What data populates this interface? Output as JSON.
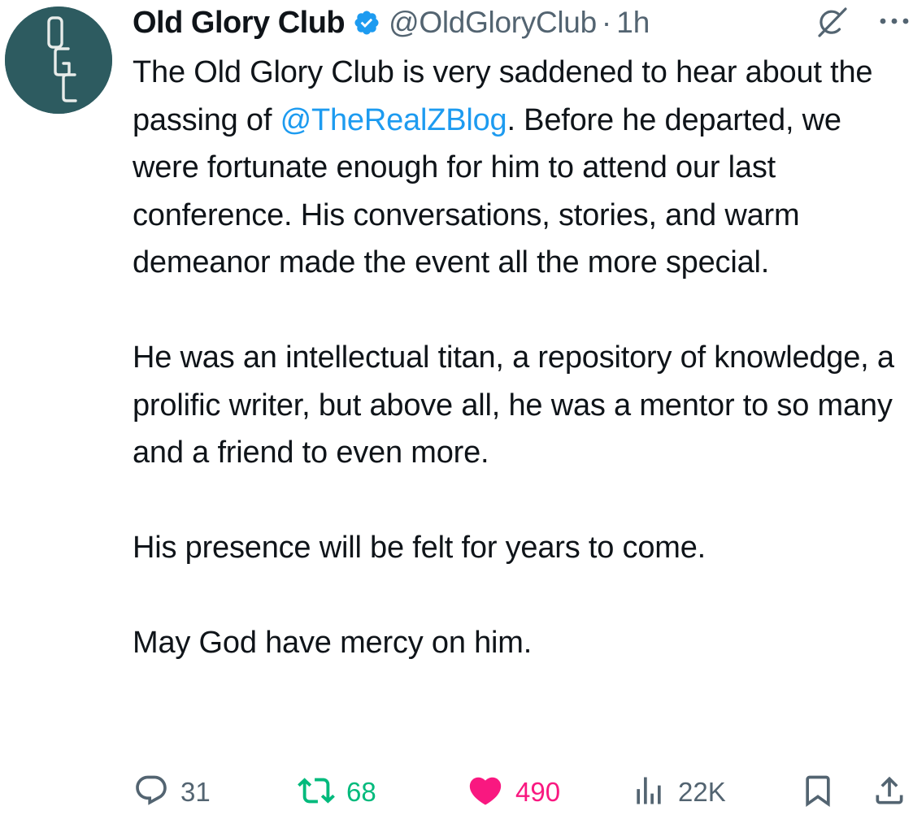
{
  "colors": {
    "avatar_bg": "#2d5b60",
    "verified": "#1d9bf0",
    "mention": "#1d9bf0",
    "retweet_active": "#00ba7c",
    "like_active": "#f91880",
    "muted": "#536471",
    "text": "#0f1419"
  },
  "author": {
    "display_name": "Old Glory Club",
    "handle": "@OldGloryClub",
    "separator": "·",
    "time": "1h",
    "verified": true,
    "avatar_monogram": "OGC"
  },
  "icons": {
    "avatar": "avatar-monogram",
    "verified": "verified-badge-icon",
    "grok": "grok-icon",
    "more": "more-options-icon",
    "reply": "reply-icon",
    "retweet": "retweet-icon",
    "like": "heart-icon",
    "views": "views-icon",
    "bookmark": "bookmark-icon",
    "share": "share-icon"
  },
  "tweet": {
    "p1_before": "The Old Glory Club is very saddened to hear about the passing of ",
    "p1_mention": "@TheRealZBlog",
    "p1_after": ". Before he departed, we were fortunate enough for him to attend our last conference. His conversations, stories, and warm demeanor made the event all the more special.",
    "p2": "He was an intellectual titan, a repository of knowledge, a prolific writer, but above all, he was a mentor to so many and a friend to even more.",
    "p3": "His presence will be felt for years to come.",
    "p4": "May God have mercy on him."
  },
  "actions": {
    "replies": "31",
    "retweets": "68",
    "likes": "490",
    "views": "22K",
    "liked": true,
    "retweeted": true
  }
}
